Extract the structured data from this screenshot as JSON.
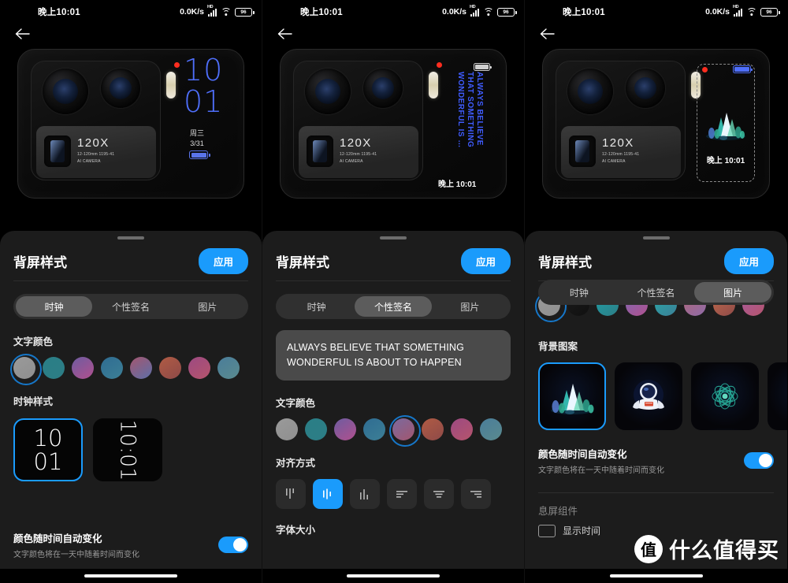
{
  "statusbar": {
    "time": "晚上10:01",
    "network_speed": "0.0K/s",
    "hd_label": "HD",
    "battery_percent": "96"
  },
  "preview": {
    "camera": {
      "zoom_label": "120X",
      "spec_line1": "12-120mm 1195-41",
      "spec_line2": "AI CAMERA"
    },
    "clock_screen": {
      "hour": "10",
      "minute": "01",
      "weekday": "周三",
      "date": "3/31"
    },
    "signature_screen": {
      "line1": "ALWAYS BELIEVE",
      "line2": "THAT SOMETHING",
      "line3": "WONDERFUL IS …",
      "time": "晚上 10:01"
    },
    "picture_screen": {
      "time": "晚上 10:01"
    }
  },
  "sheet": {
    "title": "背屏样式",
    "apply_label": "应用",
    "tabs": [
      {
        "label": "时钟"
      },
      {
        "label": "个性签名"
      },
      {
        "label": "图片"
      }
    ],
    "text_color_label": "文字颜色",
    "clock_style_label": "时钟样式",
    "align_label": "对齐方式",
    "font_size_label": "字体大小",
    "background_pattern_label": "背景图案",
    "aod_widget_label": "息屏组件",
    "aod_widget_item": "显示时间",
    "auto_color": {
      "title": "颜色随时间自动变化",
      "subtitle": "文字颜色将在一天中随着时间而变化"
    },
    "signature_text": "ALWAYS BELIEVE THAT SOMETHING WONDERFUL IS ABOUT TO HAPPEN",
    "swatches": [
      "#8f8f8f",
      "#2d7d85",
      "#9b4f8e",
      "#30708f",
      "#7a5a9e",
      "#a85040",
      "#a8456e",
      "#4a7f94"
    ],
    "swatches_gradient_b": [
      "#9a9a9a",
      "#2a6a78",
      "#b05a94",
      "#2f6c92",
      "#a35c8a",
      "#b35b42",
      "#9c4a82",
      "#4a7d9a"
    ],
    "clock_styles": [
      {
        "name": "stacked",
        "line1": "10",
        "line2": "01"
      },
      {
        "name": "rotated",
        "text": "10:01"
      }
    ]
  },
  "screens": {
    "clock_tab_index": 0,
    "signature_tab_index": 1,
    "picture_tab_index": 2,
    "selected_swatch_clock": 0,
    "selected_swatch_signature": 4,
    "selected_align": 1,
    "selected_clock_style": 0,
    "selected_pattern": 0
  },
  "watermark": {
    "badge": "值",
    "text": "什么值得买"
  },
  "colors": {
    "accent": "#1a9bfc",
    "sheet_bg": "#1c1c1c",
    "clock_preview": "#4f6ffb",
    "signature_preview": "#3f5cff"
  }
}
